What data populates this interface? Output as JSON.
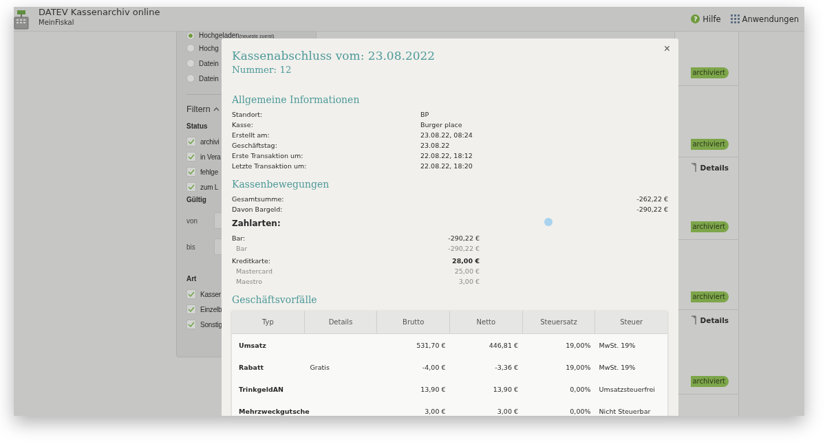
{
  "header": {
    "title": "DATEV Kassenarchiv online",
    "subtitle": "MeinFiskal",
    "help": {
      "icon": "?",
      "label": "Hilfe"
    },
    "apps": {
      "label": "Anwendungen"
    }
  },
  "sidebar": {
    "sort_options": [
      {
        "label": "Hochgeladen",
        "note": "(neueste zuerst)",
        "selected": true
      },
      {
        "label": "Hochg",
        "selected": false
      },
      {
        "label": "Datein",
        "selected": false
      },
      {
        "label": "Datein",
        "selected": false
      }
    ],
    "filter_title": "Filtern",
    "status_title": "Status",
    "status": [
      {
        "label": "archivi",
        "checked": true
      },
      {
        "label": "in Vera",
        "checked": true
      },
      {
        "label": "fehlge",
        "checked": true
      },
      {
        "label": "zum L",
        "checked": true
      }
    ],
    "valid_title": "Gültig",
    "valid_from": {
      "label": "von"
    },
    "valid_to": {
      "label": "bis"
    },
    "type_title": "Art",
    "types": [
      {
        "label": "Kasser",
        "checked": true
      },
      {
        "label": "Einzelb",
        "checked": true
      },
      {
        "label": "Sonstig",
        "checked": true
      }
    ]
  },
  "list_rows": [
    {
      "status": "archiviert"
    },
    {
      "status": "archiviert"
    },
    {
      "status": "archiviert",
      "details": "Details"
    },
    {
      "status": "archiviert"
    },
    {
      "status": "archiviert",
      "details": "Details"
    }
  ],
  "modal": {
    "close": "×",
    "title": "Kassenabschluss vom: 23.08.2022",
    "subtitle": "Nummer: 12",
    "general_title": "Allgemeine Informationen",
    "general": [
      {
        "label": "Standort:",
        "value": "BP"
      },
      {
        "label": "Kasse:",
        "value": "Burger place"
      },
      {
        "label": "Erstellt am:",
        "value": "23.08.22, 08:24"
      },
      {
        "label": "Geschäftstag:",
        "value": "23.08.22"
      },
      {
        "label": "Erste Transaktion um:",
        "value": "22.08.22, 18:12"
      },
      {
        "label": "Letzte Transaktion um:",
        "value": "22.08.22, 18:20"
      }
    ],
    "movements_title": "Kassenbewegungen",
    "movements": [
      {
        "label": "Gesamtsumme:",
        "value": "-262,22 €"
      },
      {
        "label": "Davon Bargeld:",
        "value": "-290,22 €"
      }
    ],
    "payments_title": "Zahlarten:",
    "payments": [
      {
        "label": "Bar:",
        "value": "-290,22 €",
        "kind": "group"
      },
      {
        "label": "Bar",
        "value": "-290,22 €",
        "kind": "sub"
      },
      {
        "label": "Kreditkarte:",
        "value": "28,00 €",
        "kind": "total"
      },
      {
        "label": "Mastercard",
        "value": "25,00 €",
        "kind": "sub"
      },
      {
        "label": "Maestro",
        "value": "3,00 €",
        "kind": "sub"
      }
    ],
    "transactions_title": "Geschäftsvorfälle",
    "table": {
      "columns": [
        "Typ",
        "Details",
        "Brutto",
        "Netto",
        "Steuersatz",
        "Steuer"
      ],
      "rows": [
        [
          "Umsatz",
          "",
          "531,70 €",
          "446,81 €",
          "19,00%",
          "MwSt. 19%"
        ],
        [
          "Rabatt",
          "Gratis",
          "-4,00 €",
          "-3,36 €",
          "19,00%",
          "MwSt. 19%"
        ],
        [
          "TrinkgeldAN",
          "",
          "13,90 €",
          "13,90 €",
          "0,00%",
          "Umsatzsteuerfrei"
        ],
        [
          "Mehrzweckgutsche",
          "",
          "3,00 €",
          "3,00 €",
          "0,00%",
          "Nicht Steuerbar"
        ]
      ]
    }
  }
}
